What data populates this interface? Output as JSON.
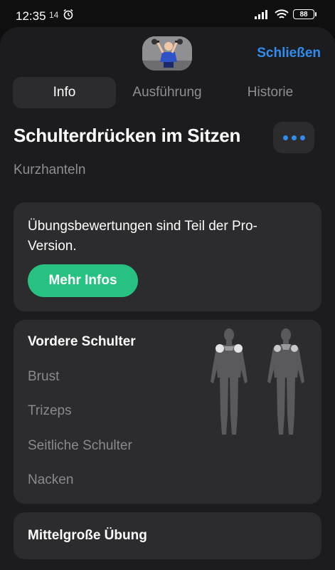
{
  "status_bar": {
    "time": "12:35",
    "superscript": "14",
    "battery": "88"
  },
  "header": {
    "close_label": "Schließen"
  },
  "tabs": [
    {
      "label": "Info",
      "active": true
    },
    {
      "label": "Ausführung",
      "active": false
    },
    {
      "label": "Historie",
      "active": false
    }
  ],
  "exercise": {
    "title": "Schulterdrücken im Sitzen",
    "equipment": "Kurzhanteln"
  },
  "pro_card": {
    "text": "Übungsbewertungen sind Teil der Pro-Version.",
    "button_label": "Mehr Infos"
  },
  "muscles": {
    "primary": [
      "Vordere Schulter"
    ],
    "secondary": [
      "Brust",
      "Trizeps",
      "Seitliche Schulter",
      "Nacken"
    ]
  },
  "level": {
    "label": "Mittelgroße Übung"
  },
  "icons": {
    "alarm": "alarm-clock-icon",
    "signal": "cell-signal-icon",
    "wifi": "wifi-icon",
    "more": "more-dots-icon"
  },
  "colors": {
    "accent_blue": "#2f8df0",
    "accent_green": "#27c281",
    "card": "#2c2c2e",
    "sheet": "#1c1c1e",
    "muscle_highlight": "#e4e4e6"
  }
}
